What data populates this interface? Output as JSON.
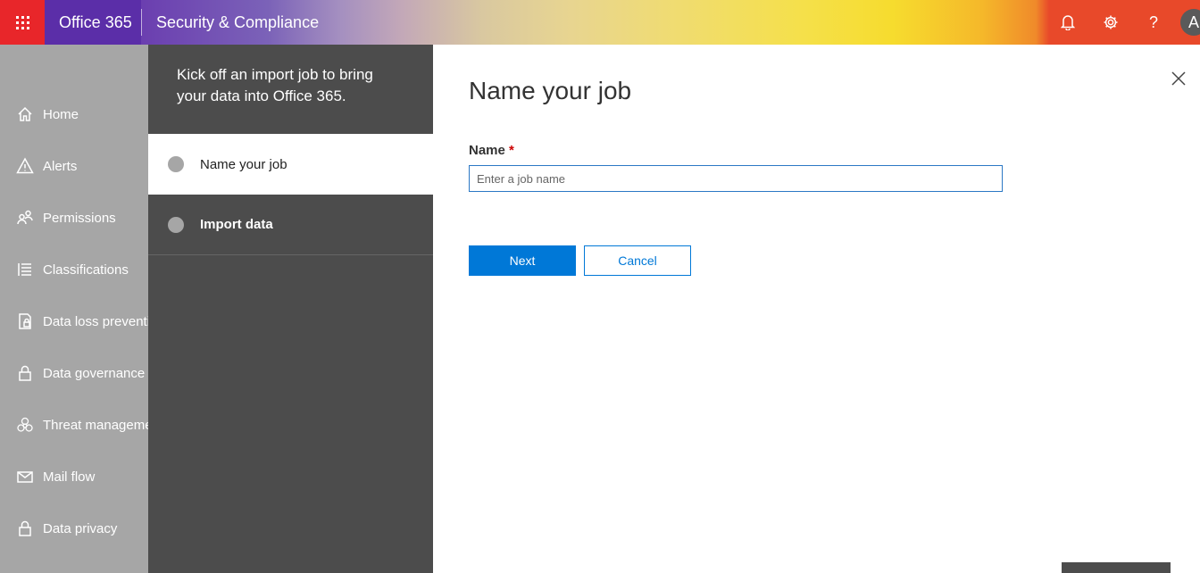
{
  "topbar": {
    "brand": "Office 365",
    "app_title": "Security & Compliance",
    "avatar_initial": "A",
    "help_glyph": "?"
  },
  "leftnav": {
    "items": [
      {
        "label": "Home",
        "icon": "home-icon"
      },
      {
        "label": "Alerts",
        "icon": "alert-icon"
      },
      {
        "label": "Permissions",
        "icon": "permissions-icon"
      },
      {
        "label": "Classifications",
        "icon": "list-icon"
      },
      {
        "label": "Data loss prevention",
        "icon": "dlp-icon"
      },
      {
        "label": "Data governance",
        "icon": "lock-icon"
      },
      {
        "label": "Threat management",
        "icon": "biohazard-icon"
      },
      {
        "label": "Mail flow",
        "icon": "mail-icon"
      },
      {
        "label": "Data privacy",
        "icon": "lock-icon"
      }
    ]
  },
  "wizard": {
    "header": "Kick off an import job to bring your data into Office 365.",
    "steps": [
      {
        "label": "Name your job",
        "state": "active"
      },
      {
        "label": "Import data",
        "state": "inactive"
      }
    ]
  },
  "main": {
    "title": "Name your job",
    "field_label": "Name",
    "required_marker": "*",
    "input_placeholder": "Enter a job name",
    "input_value": "",
    "next_label": "Next",
    "cancel_label": "Cancel"
  },
  "colors": {
    "accent": "#0078d7",
    "nav_bg": "#a6a6a6",
    "steps_bg": "#4c4c4c",
    "waffle": "#e8262a",
    "brand_bg": "#5b2ea8"
  }
}
